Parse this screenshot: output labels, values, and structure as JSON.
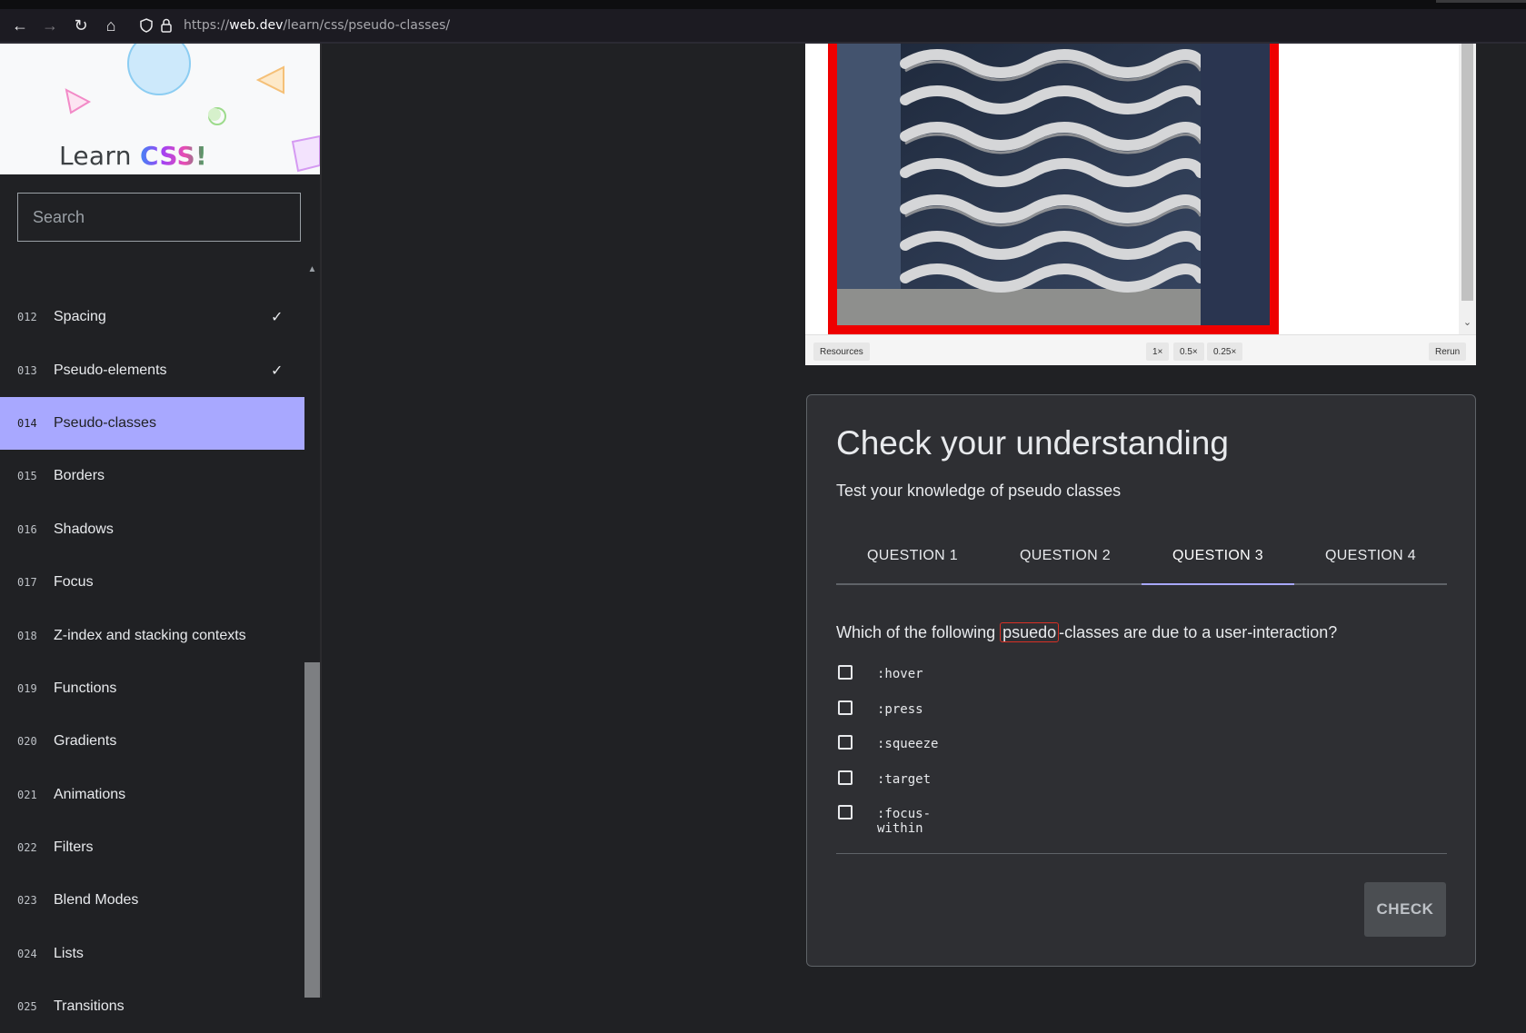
{
  "browser": {
    "url_prefix": "https://",
    "url_host": "web.dev",
    "url_path": "/learn/css/pseudo-classes/",
    "back_icon": "←",
    "forward_icon": "→",
    "reload_icon": "↻",
    "home_icon": "⌂"
  },
  "sidebar": {
    "logo_learn": "Learn",
    "logo_css": "CSS!",
    "search_placeholder": "Search",
    "items": [
      {
        "num": "012",
        "label": "Spacing",
        "done": "✓"
      },
      {
        "num": "013",
        "label": "Pseudo-elements",
        "done": "✓"
      },
      {
        "num": "014",
        "label": "Pseudo-classes",
        "done": ""
      },
      {
        "num": "015",
        "label": "Borders",
        "done": ""
      },
      {
        "num": "016",
        "label": "Shadows",
        "done": ""
      },
      {
        "num": "017",
        "label": "Focus",
        "done": ""
      },
      {
        "num": "018",
        "label": "Z-index and stacking contexts",
        "done": ""
      },
      {
        "num": "019",
        "label": "Functions",
        "done": ""
      },
      {
        "num": "020",
        "label": "Gradients",
        "done": ""
      },
      {
        "num": "021",
        "label": "Animations",
        "done": ""
      },
      {
        "num": "022",
        "label": "Filters",
        "done": ""
      },
      {
        "num": "023",
        "label": "Blend Modes",
        "done": ""
      },
      {
        "num": "024",
        "label": "Lists",
        "done": ""
      },
      {
        "num": "025",
        "label": "Transitions",
        "done": ""
      }
    ],
    "active_index": 2
  },
  "demo": {
    "resources_label": "Resources",
    "zoom_1x": "1×",
    "zoom_05x": "0.5×",
    "zoom_025x": "0.25×",
    "rerun_label": "Rerun"
  },
  "quiz": {
    "title": "Check your understanding",
    "subtitle": "Test your knowledge of pseudo classes",
    "tabs": [
      "QUESTION 1",
      "QUESTION 2",
      "QUESTION 3",
      "QUESTION 4"
    ],
    "active_tab": 2,
    "question_before": "Which of the following ",
    "question_highlight": "psuedo",
    "question_after": "-classes are due to a user-interaction?",
    "options": [
      ":hover",
      ":press",
      ":squeeze",
      ":target",
      ":focus-within"
    ],
    "check_label": "CHECK"
  },
  "colors": {
    "accent": "#a8a8ff",
    "page_bg": "#202124",
    "card_bg": "#2e2f33"
  }
}
